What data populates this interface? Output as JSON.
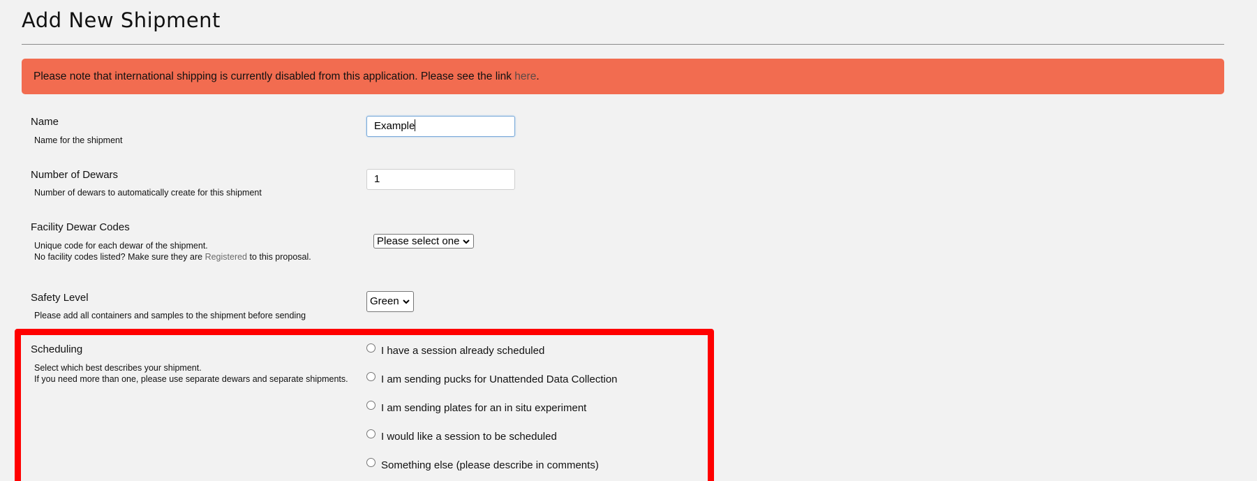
{
  "page": {
    "title": "Add New Shipment"
  },
  "notice": {
    "text": "Please note that international shipping is currently disabled from this application. Please see the link ",
    "link": "here",
    "suffix": "."
  },
  "form": {
    "name": {
      "label": "Name",
      "help": "Name for the shipment",
      "value": "Example"
    },
    "dewars": {
      "label": "Number of Dewars",
      "help": "Number of dewars to automatically create for this shipment",
      "value": "1"
    },
    "facility_codes": {
      "label": "Facility Dewar Codes",
      "help_line1": "Unique code for each dewar of the shipment.",
      "help_line2_prefix": "No facility codes listed? Make sure they are ",
      "help_line2_link": "Registered",
      "help_line2_suffix": " to this proposal.",
      "selected": "Please select one"
    },
    "safety": {
      "label": "Safety Level",
      "help": "Please add all containers and samples to the shipment before sending",
      "selected": "Green"
    },
    "scheduling": {
      "label": "Scheduling",
      "help_line1": "Select which best describes your shipment.",
      "help_line2": "If you need more than one, please use separate dewars and separate shipments.",
      "options": [
        "I have a session already scheduled",
        "I am sending pucks for Unattended Data Collection",
        "I am sending plates for an in situ experiment",
        "I would like a session to be scheduled",
        "Something else (please describe in comments)"
      ]
    }
  },
  "colors": {
    "notice_bg": "#f26c50",
    "highlight": "#ff0000",
    "background": "#f2f2f2"
  }
}
